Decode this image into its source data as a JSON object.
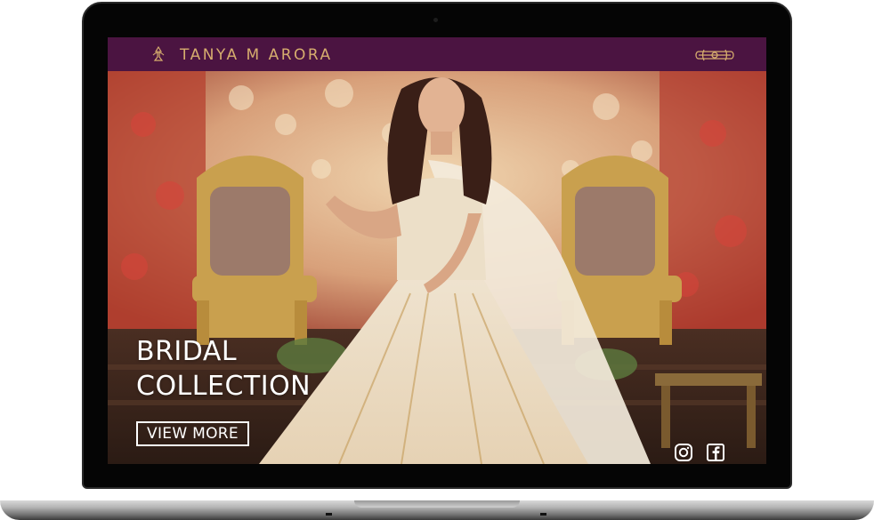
{
  "site": {
    "brand_name": "TANYA M ARORA",
    "header_color": "#4b1441",
    "accent_color": "#d6ad6e"
  },
  "hero": {
    "title_line1": "BRIDAL",
    "title_line2": "COLLECTION",
    "cta_label": "VIEW MORE"
  },
  "icons": {
    "logo": "brand-monogram-icon",
    "menu": "ornate-menu-icon",
    "social": [
      "instagram-icon",
      "facebook-icon"
    ]
  }
}
